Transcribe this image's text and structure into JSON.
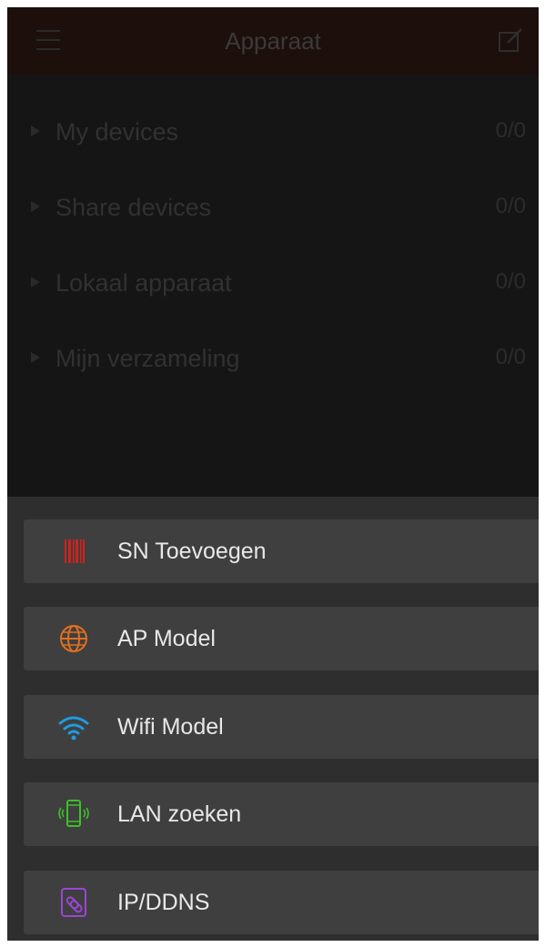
{
  "header": {
    "title": "Apparaat"
  },
  "device_groups": [
    {
      "label": "My devices",
      "count": "0/0"
    },
    {
      "label": "Share devices",
      "count": "0/0"
    },
    {
      "label": "Lokaal apparaat",
      "count": "0/0"
    },
    {
      "label": "Mijn verzameling",
      "count": "0/0"
    }
  ],
  "add_menu": {
    "items": [
      {
        "label": "SN Toevoegen",
        "icon": "barcode-icon",
        "color": "#d0221e"
      },
      {
        "label": "AP Model",
        "icon": "globe-icon",
        "color": "#e0701f"
      },
      {
        "label": "Wifi Model",
        "icon": "wifi-icon",
        "color": "#1f9be0"
      },
      {
        "label": "LAN zoeken",
        "icon": "phone-search-icon",
        "color": "#3fbf2a"
      },
      {
        "label": "IP/DDNS",
        "icon": "link-icon",
        "color": "#9b46d6"
      }
    ]
  }
}
